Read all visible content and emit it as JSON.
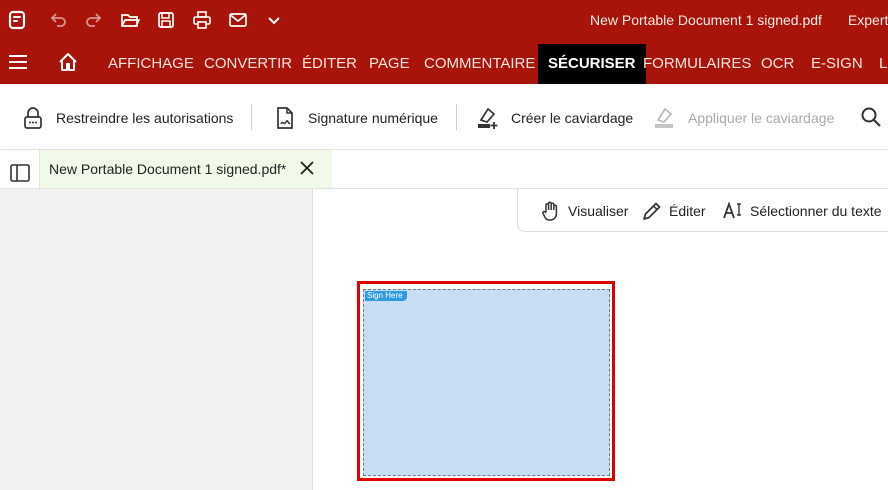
{
  "window": {
    "title": "New Portable Document 1 signed.pdf",
    "title_suffix": "Expert"
  },
  "quick_access": [
    "app-logo-icon",
    "undo-icon",
    "redo-icon",
    "open-folder-icon",
    "save-icon",
    "print-icon",
    "mail-icon",
    "chevron-down-icon"
  ],
  "menu": {
    "tabs": [
      {
        "label": "AFFICHAGE"
      },
      {
        "label": "CONVERTIR"
      },
      {
        "label": "ÉDITER"
      },
      {
        "label": "PAGE"
      },
      {
        "label": "COMMENTAIRE"
      },
      {
        "label": "SÉCURISER",
        "active": true
      },
      {
        "label": "FORMULAIRES"
      },
      {
        "label": "OCR"
      },
      {
        "label": "E-SIGN"
      },
      {
        "label": "LO"
      }
    ]
  },
  "ribbon": {
    "restrict_label": "Restreindre les autorisations",
    "signature_label": "Signature numérique",
    "create_redaction_label": "Créer le caviardage",
    "apply_redaction_label": "Appliquer le caviardage"
  },
  "document_tab": {
    "name": "New Portable Document 1 signed.pdf*"
  },
  "tools": {
    "view_label": "Visualiser",
    "edit_label": "Éditer",
    "select_text_label": "Sélectionner du texte"
  },
  "signature_field": {
    "tag": "Sign Here"
  },
  "colors": {
    "brand": "#a81409",
    "active_tab": "#000000",
    "doc_tab_bg": "#f1fae9",
    "sig_fill": "#c7ddf3",
    "sig_border": "#e00000",
    "sig_tag": "#2e9be0"
  }
}
